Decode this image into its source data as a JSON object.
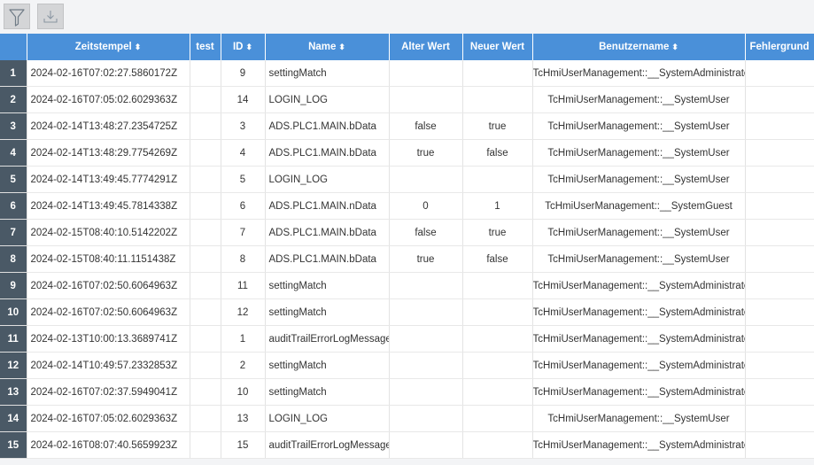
{
  "toolbar": {
    "filter_icon": "filter-icon",
    "export_icon": "download-icon"
  },
  "columns": [
    {
      "label": "",
      "sortable": false
    },
    {
      "label": "Zeitstempel",
      "sortable": true
    },
    {
      "label": "test",
      "sortable": false
    },
    {
      "label": "ID",
      "sortable": true
    },
    {
      "label": "Name",
      "sortable": true
    },
    {
      "label": "Alter Wert",
      "sortable": false
    },
    {
      "label": "Neuer Wert",
      "sortable": false
    },
    {
      "label": "Benutzername",
      "sortable": true
    },
    {
      "label": "Fehlergrund",
      "sortable": false
    }
  ],
  "sort_glyph": "⬍",
  "colors": {
    "header_bg": "#4a90d9",
    "rownum_bg": "#4a5966"
  },
  "rows": [
    {
      "n": "1",
      "zeitstempel": "2024-02-16T07:02:27.5860172Z",
      "test": "",
      "id": "9",
      "name": "settingMatch",
      "alter": "",
      "neuer": "",
      "user": "TcHmiUserManagement::__SystemAdministrator",
      "fehler": ""
    },
    {
      "n": "2",
      "zeitstempel": "2024-02-16T07:05:02.6029363Z",
      "test": "",
      "id": "14",
      "name": "LOGIN_LOG",
      "alter": "",
      "neuer": "",
      "user": "TcHmiUserManagement::__SystemUser",
      "fehler": ""
    },
    {
      "n": "3",
      "zeitstempel": "2024-02-14T13:48:27.2354725Z",
      "test": "",
      "id": "3",
      "name": "ADS.PLC1.MAIN.bData",
      "alter": "false",
      "neuer": "true",
      "user": "TcHmiUserManagement::__SystemUser",
      "fehler": ""
    },
    {
      "n": "4",
      "zeitstempel": "2024-02-14T13:48:29.7754269Z",
      "test": "",
      "id": "4",
      "name": "ADS.PLC1.MAIN.bData",
      "alter": "true",
      "neuer": "false",
      "user": "TcHmiUserManagement::__SystemUser",
      "fehler": ""
    },
    {
      "n": "5",
      "zeitstempel": "2024-02-14T13:49:45.7774291Z",
      "test": "",
      "id": "5",
      "name": "LOGIN_LOG",
      "alter": "",
      "neuer": "",
      "user": "TcHmiUserManagement::__SystemUser",
      "fehler": ""
    },
    {
      "n": "6",
      "zeitstempel": "2024-02-14T13:49:45.7814338Z",
      "test": "",
      "id": "6",
      "name": "ADS.PLC1.MAIN.nData",
      "alter": "0",
      "neuer": "1",
      "user": "TcHmiUserManagement::__SystemGuest",
      "fehler": ""
    },
    {
      "n": "7",
      "zeitstempel": "2024-02-15T08:40:10.5142202Z",
      "test": "",
      "id": "7",
      "name": "ADS.PLC1.MAIN.bData",
      "alter": "false",
      "neuer": "true",
      "user": "TcHmiUserManagement::__SystemUser",
      "fehler": ""
    },
    {
      "n": "8",
      "zeitstempel": "2024-02-15T08:40:11.1151438Z",
      "test": "",
      "id": "8",
      "name": "ADS.PLC1.MAIN.bData",
      "alter": "true",
      "neuer": "false",
      "user": "TcHmiUserManagement::__SystemUser",
      "fehler": ""
    },
    {
      "n": "9",
      "zeitstempel": "2024-02-16T07:02:50.6064963Z",
      "test": "",
      "id": "11",
      "name": "settingMatch",
      "alter": "",
      "neuer": "",
      "user": "TcHmiUserManagement::__SystemAdministrator",
      "fehler": ""
    },
    {
      "n": "10",
      "zeitstempel": "2024-02-16T07:02:50.6064963Z",
      "test": "",
      "id": "12",
      "name": "settingMatch",
      "alter": "",
      "neuer": "",
      "user": "TcHmiUserManagement::__SystemAdministrator",
      "fehler": ""
    },
    {
      "n": "11",
      "zeitstempel": "2024-02-13T10:00:13.3689741Z",
      "test": "",
      "id": "1",
      "name": "auditTrailErrorLogMessage",
      "alter": "",
      "neuer": "",
      "user": "TcHmiUserManagement::__SystemAdministrator",
      "fehler": ""
    },
    {
      "n": "12",
      "zeitstempel": "2024-02-14T10:49:57.2332853Z",
      "test": "",
      "id": "2",
      "name": "settingMatch",
      "alter": "",
      "neuer": "",
      "user": "TcHmiUserManagement::__SystemAdministrator",
      "fehler": ""
    },
    {
      "n": "13",
      "zeitstempel": "2024-02-16T07:02:37.5949041Z",
      "test": "",
      "id": "10",
      "name": "settingMatch",
      "alter": "",
      "neuer": "",
      "user": "TcHmiUserManagement::__SystemAdministrator",
      "fehler": ""
    },
    {
      "n": "14",
      "zeitstempel": "2024-02-16T07:05:02.6029363Z",
      "test": "",
      "id": "13",
      "name": "LOGIN_LOG",
      "alter": "",
      "neuer": "",
      "user": "TcHmiUserManagement::__SystemUser",
      "fehler": ""
    },
    {
      "n": "15",
      "zeitstempel": "2024-02-16T08:07:40.5659923Z",
      "test": "",
      "id": "15",
      "name": "auditTrailErrorLogMessage",
      "alter": "",
      "neuer": "",
      "user": "TcHmiUserManagement::__SystemAdministrator",
      "fehler": ""
    }
  ]
}
